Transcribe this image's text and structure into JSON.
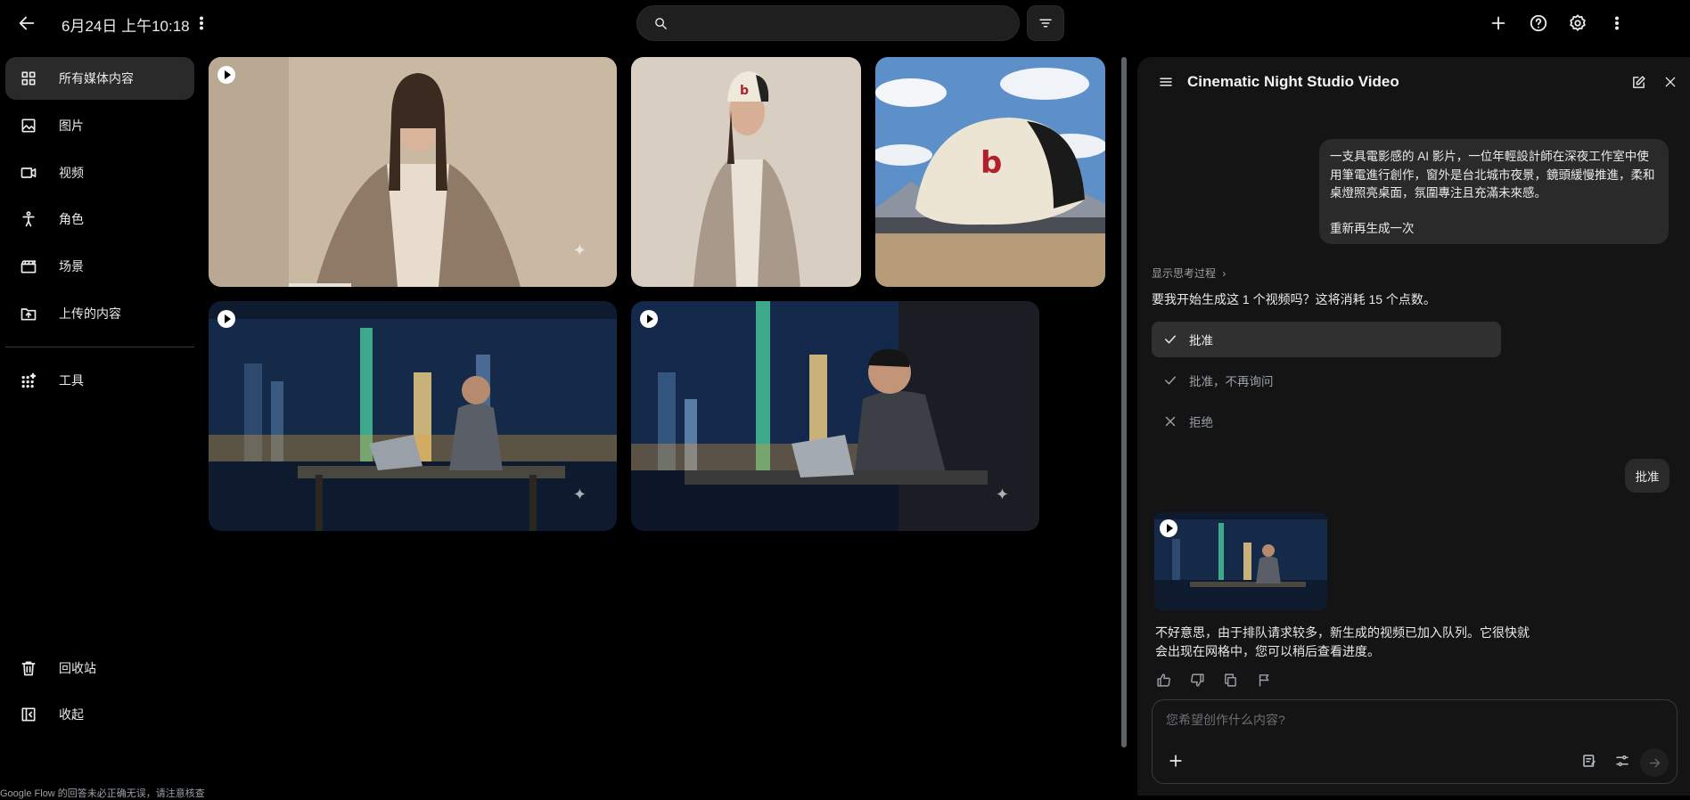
{
  "header": {
    "date": "6月24日 上午10:18",
    "search_value": ""
  },
  "sidebar": {
    "items": [
      {
        "label": "所有媒体内容",
        "icon": "grid-icon"
      },
      {
        "label": "图片",
        "icon": "image-icon"
      },
      {
        "label": "视频",
        "icon": "video-icon"
      },
      {
        "label": "角色",
        "icon": "person-icon"
      },
      {
        "label": "场景",
        "icon": "clapperboard-icon"
      },
      {
        "label": "上传的内容",
        "icon": "upload-icon"
      },
      {
        "label": "工具",
        "icon": "tools-icon"
      }
    ],
    "bottom": [
      {
        "label": "回收站",
        "icon": "trash-icon"
      },
      {
        "label": "收起",
        "icon": "collapse-icon"
      }
    ]
  },
  "panel": {
    "title": "Cinematic Night Studio Video",
    "user_message": "一支具電影感的 AI 影片，一位年輕設計師在深夜工作室中使用筆電進行創作，窗外是台北城市夜景，鏡頭緩慢推進，柔和桌燈照亮桌面，氛圍專注且充滿未來感。",
    "user_message_2": "重新再生成一次",
    "show_thinking": "显示思考过程",
    "question": "要我开始生成这 1 个视频吗？这将消耗 15 个点数。",
    "options": [
      "批准",
      "批准，不再询问",
      "拒绝"
    ],
    "reply": "批准",
    "bot_message": "不好意思，由于排队请求较多，新生成的视频已加入队列。它很快就会出现在网格中，您可以稍后查看进度。",
    "composer_placeholder": "您希望创作什么内容?"
  },
  "footer": {
    "disclaimer": "Google Flow 的回答未必正确无误，请注意核查"
  }
}
